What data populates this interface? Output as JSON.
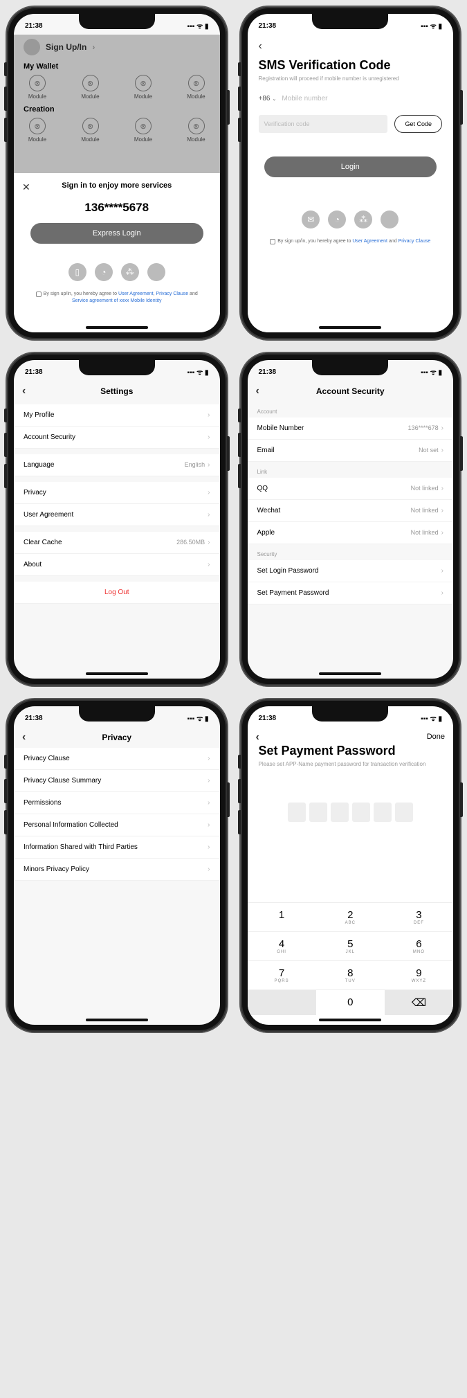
{
  "status": {
    "time": "21:38",
    "signal": "▪▪▪▪",
    "wifi": "⌢",
    "batt": "■"
  },
  "s1": {
    "signup": "Sign Up/In",
    "wallet": "My Wallet",
    "creation": "Creation",
    "module": "Module",
    "sheet_title": "Sign in to enjoy more services",
    "phone": "136****5678",
    "express": "Express Login",
    "agree_pre": "By sign up/in, you hereby agree to ",
    "ua": "User Agreement",
    "pc": "Privacy Clause",
    "and": " and ",
    "sa": "Service agreement of xxxx Mobile Identity"
  },
  "s2": {
    "title": "SMS Verification Code",
    "sub": "Registration will proceed if mobile number is unregistered",
    "prefix": "+86",
    "phone_ph": "Mobile number",
    "code_ph": "Verification code",
    "getcode": "Get Code",
    "login": "Login",
    "agree_pre": "By sign up/in, you hereby agree to ",
    "ua": "User Agreement",
    "and": " and ",
    "pc": "Privacy Clause"
  },
  "s3": {
    "title": "Settings",
    "rows": {
      "profile": "My Profile",
      "security": "Account Security",
      "language": "Language",
      "language_val": "English",
      "privacy": "Privacy",
      "ua": "User Agreement",
      "cache": "Clear Cache",
      "cache_val": "286.50MB",
      "about": "About",
      "logout": "Log Out"
    }
  },
  "s4": {
    "title": "Account Security",
    "acct": "Account",
    "mobile": "Mobile Number",
    "mobile_val": "136****678",
    "email": "Email",
    "email_val": "Not set",
    "link": "Link",
    "qq": "QQ",
    "qq_val": "Not linked",
    "wechat": "Wechat",
    "wechat_val": "Not linked",
    "apple": "Apple",
    "apple_val": "Not linked",
    "sec": "Security",
    "login_pw": "Set Login Password",
    "pay_pw": "Set Payment Password"
  },
  "s5": {
    "title": "Privacy",
    "r1": "Privacy Clause",
    "r2": "Privacy Clause Summary",
    "r3": "Permissions",
    "r4": "Personal Information Collected",
    "r5": "Information Shared with Third Parties",
    "r6": "Minors Privacy Policy"
  },
  "s6": {
    "done": "Done",
    "title": "Set Payment Password",
    "sub": "Please set APP-Name payment password for transaction verification",
    "keys": {
      "k1": "1",
      "k2": "2",
      "k3": "3",
      "k4": "4",
      "k5": "5",
      "k6": "6",
      "k7": "7",
      "k8": "8",
      "k9": "9",
      "k0": "0",
      "abc": "ABC",
      "def": "DEF",
      "ghi": "GHI",
      "jkl": "JKL",
      "mno": "MNO",
      "pqrs": "PQRS",
      "tuv": "TUV",
      "wxyz": "WXYZ"
    }
  }
}
